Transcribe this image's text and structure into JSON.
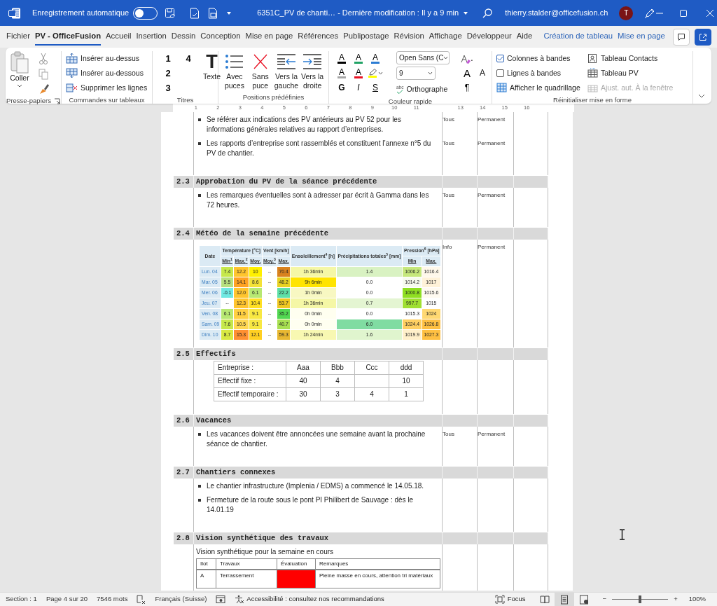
{
  "title_bar": {
    "autosave_label": "Enregistrement automatique",
    "autosave_on": false,
    "document": "6351C_PV de chanti…  -  Dernière modification : Il y a 9 min",
    "account": "thierry.stalder@officefusion.ch",
    "avatar": "T"
  },
  "menu_tabs": [
    {
      "label": "Fichier",
      "selected": false,
      "contextual": false
    },
    {
      "label": "PV - OfficeFusion",
      "selected": true,
      "contextual": false
    },
    {
      "label": "Accueil",
      "selected": false,
      "contextual": false
    },
    {
      "label": "Insertion",
      "selected": false,
      "contextual": false
    },
    {
      "label": "Dessin",
      "selected": false,
      "contextual": false
    },
    {
      "label": "Conception",
      "selected": false,
      "contextual": false
    },
    {
      "label": "Mise en page",
      "selected": false,
      "contextual": false
    },
    {
      "label": "Références",
      "selected": false,
      "contextual": false
    },
    {
      "label": "Publipostage",
      "selected": false,
      "contextual": false
    },
    {
      "label": "Révision",
      "selected": false,
      "contextual": false
    },
    {
      "label": "Affichage",
      "selected": false,
      "contextual": false
    },
    {
      "label": "Développeur",
      "selected": false,
      "contextual": false
    },
    {
      "label": "Aide",
      "selected": false,
      "contextual": false
    },
    {
      "label": "Création de tableau",
      "selected": false,
      "contextual": true
    },
    {
      "label": "Mise en page",
      "selected": false,
      "contextual": true
    }
  ],
  "ribbon": {
    "groups": [
      {
        "kind": "clipboard",
        "label": "Presse-papiers",
        "paste": "Coller"
      },
      {
        "kind": "commands",
        "label": "Commandes sur tableaux",
        "commands": [
          "Insérer au-dessus",
          "Insérer au-dessous",
          "Supprimer les lignes"
        ]
      },
      {
        "kind": "headings",
        "label": "Titres",
        "levels": [
          "1",
          "2",
          "3",
          "4"
        ],
        "text_glyph": "T",
        "text_label": "Texte"
      },
      {
        "kind": "bullets",
        "label": "Positions prédéfinies",
        "buttons": [
          "Avec puces",
          "Sans puce",
          "Vers la gauche",
          "Vers la droite"
        ]
      },
      {
        "kind": "quick-color",
        "label": "Couleur rapide",
        "colors": [
          {
            "glyph": "A",
            "color": "#000000"
          },
          {
            "glyph": "A",
            "color": "#21a366"
          },
          {
            "glyph": "A",
            "color": "#2b7cd3"
          },
          {
            "glyph": "A",
            "color": "#a6a6a6"
          },
          {
            "glyph": "A",
            "color": "#e81123"
          }
        ],
        "highlight": {
          "color": "#ffff00"
        },
        "styles": [
          "G",
          "I",
          "S"
        ],
        "font": "Open Sans (C",
        "size": "9",
        "spelling_icon": "abc",
        "spelling": "Orthographe",
        "clear_suffix": ".",
        "size_glyphs": [
          "A",
          "A"
        ],
        "pilcrow": "¶"
      },
      {
        "kind": "table-style",
        "label": "Réinitialiser mise en forme",
        "options": [
          {
            "kind": "checkbox",
            "label": "Colonnes à bandes",
            "checked": true
          },
          {
            "kind": "command",
            "label": "Tableau Contacts",
            "disabled": false
          },
          {
            "kind": "checkbox",
            "label": "Lignes à bandes",
            "checked": false
          },
          {
            "kind": "command",
            "label": "Tableau PV",
            "disabled": false
          },
          {
            "kind": "command",
            "label": "Afficher le quadrillage",
            "disabled": false
          },
          {
            "kind": "command",
            "label": "Ajust. aut. À la fenêtre",
            "disabled": true
          }
        ]
      }
    ]
  },
  "ruler": [
    "1",
    "2",
    "3",
    "4",
    "5",
    "6",
    "7",
    "8",
    "9",
    "10",
    "11",
    "13",
    "14",
    "15",
    "16"
  ],
  "blocks": [
    {
      "kind": "bullets",
      "items": [
        {
          "text": "Se référer aux indications des PV antérieurs au PV 52 pour les informations générales relatives au rapport d’entreprises.",
          "responsible": "Tous",
          "deadline": "Permanent"
        },
        {
          "text": "Les rapports d’entreprise sont rassemblés et constituent l’annexe n°5 du PV de chantier.",
          "responsible": "Tous",
          "deadline": "Permanent"
        }
      ]
    },
    {
      "kind": "heading",
      "number": "2.3",
      "title": "Approbation du PV de la séance précédente"
    },
    {
      "kind": "bullets",
      "items": [
        {
          "text": "Les remarques éventuelles sont à adresser par écrit à Gamma dans les 72 heures.",
          "responsible": "Tous",
          "deadline": "Permanent"
        }
      ]
    },
    {
      "kind": "heading",
      "number": "2.4",
      "title": "Météo de la semaine précédente"
    },
    {
      "kind": "weather",
      "responsible": "Info",
      "deadline": "Permanent",
      "groups": [
        {
          "label": "Date"
        },
        {
          "label": "Température [°C]",
          "columns": [
            "Min$^{1}$",
            "Max.$^{2}$",
            "Moy."
          ]
        },
        {
          "label": "Vent [km/h]",
          "columns": [
            "Moy.$^{3}$",
            "Max."
          ]
        },
        {
          "label": "Ensoleillement$^{4}$ [h]"
        },
        {
          "label": "Précipitations totales$^{5}$ [mm]"
        },
        {
          "label": "Pression$^{6}$ [hPa]",
          "columns": [
            "Min",
            "Max."
          ]
        }
      ],
      "rows": [
        {
          "date": "Lun. 04",
          "cells": [
            {
              "text": "7.4",
              "color": "#c6e84c"
            },
            {
              "text": "12.2",
              "color": "#ffc52e"
            },
            {
              "text": "10",
              "color": "#fff000"
            },
            {
              "text": "--",
              "color": "#ffffff"
            },
            {
              "text": "70.4",
              "color": "#d9821e"
            },
            {
              "text": "1h 36min",
              "color": "#f5f7a6"
            },
            {
              "text": "1.4",
              "color": "#d9f2c2"
            },
            {
              "text": "1006.2",
              "color": "#c6e87c"
            },
            {
              "text": "1016.4",
              "color": "#fff8ea"
            }
          ]
        },
        {
          "date": "Mar. 05",
          "cells": [
            {
              "text": "5.5",
              "color": "#b7e07e"
            },
            {
              "text": "14.1",
              "color": "#ffa222"
            },
            {
              "text": "8.6",
              "color": "#f4e236"
            },
            {
              "text": "--",
              "color": "#ffffff"
            },
            {
              "text": "48.2",
              "color": "#e8d222"
            },
            {
              "text": "9h 6min",
              "color": "#ffe400"
            },
            {
              "text": "0.0",
              "color": "#ffffff"
            },
            {
              "text": "1014.2",
              "color": "#f7fbef"
            },
            {
              "text": "1017",
              "color": "#fff2d8"
            }
          ]
        },
        {
          "date": "Mer. 06",
          "cells": [
            {
              "text": "-0.1",
              "color": "#6fe8e2"
            },
            {
              "text": "12.0",
              "color": "#ffc52e"
            },
            {
              "text": "6.1",
              "color": "#b7e872"
            },
            {
              "text": "--",
              "color": "#ffffff"
            },
            {
              "text": "22.2",
              "color": "#5fe0a8"
            },
            {
              "text": "1h 0min",
              "color": "#f8f8c2"
            },
            {
              "text": "0.0",
              "color": "#ffffff"
            },
            {
              "text": "1000.8",
              "color": "#8fdf22"
            },
            {
              "text": "1015.6",
              "color": "#fffaf0"
            }
          ]
        },
        {
          "date": "Jeu. 07",
          "cells": [
            {
              "text": "--",
              "color": "#ffffff"
            },
            {
              "text": "12.3",
              "color": "#ffc52e"
            },
            {
              "text": "10.4",
              "color": "#ffe022"
            },
            {
              "text": "--",
              "color": "#ffffff"
            },
            {
              "text": "53.7",
              "color": "#f0c822"
            },
            {
              "text": "1h 36min",
              "color": "#f5f7a6"
            },
            {
              "text": "0.7",
              "color": "#e4f5d2"
            },
            {
              "text": "997.7",
              "color": "#a0e032"
            },
            {
              "text": "1015",
              "color": "#ffffff"
            }
          ]
        },
        {
          "date": "Ven. 08",
          "cells": [
            {
              "text": "6.1",
              "color": "#b7e872"
            },
            {
              "text": "11.5",
              "color": "#ffd042"
            },
            {
              "text": "9.1",
              "color": "#f8e842"
            },
            {
              "text": "--",
              "color": "#ffffff"
            },
            {
              "text": "35.2",
              "color": "#52d852"
            },
            {
              "text": "0h 0min",
              "color": "#fffff0"
            },
            {
              "text": "0.0",
              "color": "#ffffff"
            },
            {
              "text": "1015.3",
              "color": "#ffffff"
            },
            {
              "text": "1024",
              "color": "#ffd872"
            }
          ]
        },
        {
          "date": "Sam. 09",
          "cells": [
            {
              "text": "7.6",
              "color": "#c6e84c"
            },
            {
              "text": "10.5",
              "color": "#ffd852"
            },
            {
              "text": "9.1",
              "color": "#f8e842"
            },
            {
              "text": "--",
              "color": "#ffffff"
            },
            {
              "text": "40.7",
              "color": "#a8e052"
            },
            {
              "text": "0h 0min",
              "color": "#fffff0"
            },
            {
              "text": "6.0",
              "color": "#80dca2"
            },
            {
              "text": "1024.4",
              "color": "#ffd062"
            },
            {
              "text": "1026.8",
              "color": "#ffc042"
            }
          ]
        },
        {
          "date": "Dim. 10",
          "cells": [
            {
              "text": "8.7",
              "color": "#d8e842"
            },
            {
              "text": "15.3",
              "color": "#ff9032"
            },
            {
              "text": "12.1",
              "color": "#ffd022"
            },
            {
              "text": "--",
              "color": "#ffffff"
            },
            {
              "text": "59.3",
              "color": "#e8b832"
            },
            {
              "text": "1h 24min",
              "color": "#f8f8b2"
            },
            {
              "text": "1.6",
              "color": "#e0f5ce"
            },
            {
              "text": "1019.9",
              "color": "#fff0ca"
            },
            {
              "text": "1027.3",
              "color": "#ffc042"
            }
          ]
        }
      ]
    },
    {
      "kind": "heading",
      "number": "2.5",
      "title": "Effectifs"
    },
    {
      "kind": "staff",
      "labels": [
        "Entreprise :",
        "Effectif fixe :",
        "Effectif temporaire :"
      ],
      "companies": [
        {
          "name": "Aaa",
          "fixed": "40",
          "temporary": "30"
        },
        {
          "name": "Bbb",
          "fixed": "4",
          "temporary": "3"
        },
        {
          "name": "Ccc",
          "temporary": "4"
        },
        {
          "name": "ddd",
          "fixed": "10",
          "temporary": "1"
        }
      ]
    },
    {
      "kind": "heading",
      "number": "2.6",
      "title": "Vacances"
    },
    {
      "kind": "bullets",
      "items": [
        {
          "text": "Les vacances doivent être annoncées une semaine avant la prochaine séance de chantier.",
          "responsible": "Tous",
          "deadline": "Permanent"
        }
      ]
    },
    {
      "kind": "heading",
      "number": "2.7",
      "title": "Chantiers connexes"
    },
    {
      "kind": "bullets",
      "items": [
        {
          "text": "Le chantier infrastructure (Implenia / EDMS) a commencé le 14.05.18."
        },
        {
          "text": "Fermeture de la route sous le pont PI Philibert de Sauvage : dès le 14.01.19"
        }
      ]
    },
    {
      "kind": "heading",
      "number": "2.8",
      "title": "Vision synthétique des travaux"
    },
    {
      "kind": "overview",
      "caption": "Vision synthétique pour la semaine en cours",
      "columns": [
        "Ilot",
        "Travaux",
        "Évaluation",
        "Remarques"
      ],
      "rows": [
        {
          "ilot": "A",
          "travaux": "Terrassement",
          "color": "#ff0000",
          "remarks": "Pleine masse en cours, attention tri matériaux"
        }
      ]
    }
  ],
  "status_bar": {
    "section": "Section : 1",
    "page": "Page 4 sur 20",
    "words": "7546 mots",
    "language": "Français (Suisse)",
    "accessibility": "Accessibilité : consultez nos recommandations",
    "focus": "Focus",
    "views": [
      {
        "selected": false
      },
      {
        "selected": true
      },
      {
        "selected": false
      }
    ],
    "zoom_minus": "−",
    "zoom_plus": "+",
    "zoom": {
      "level": 0.5
    },
    "zoom_text": "100%"
  }
}
